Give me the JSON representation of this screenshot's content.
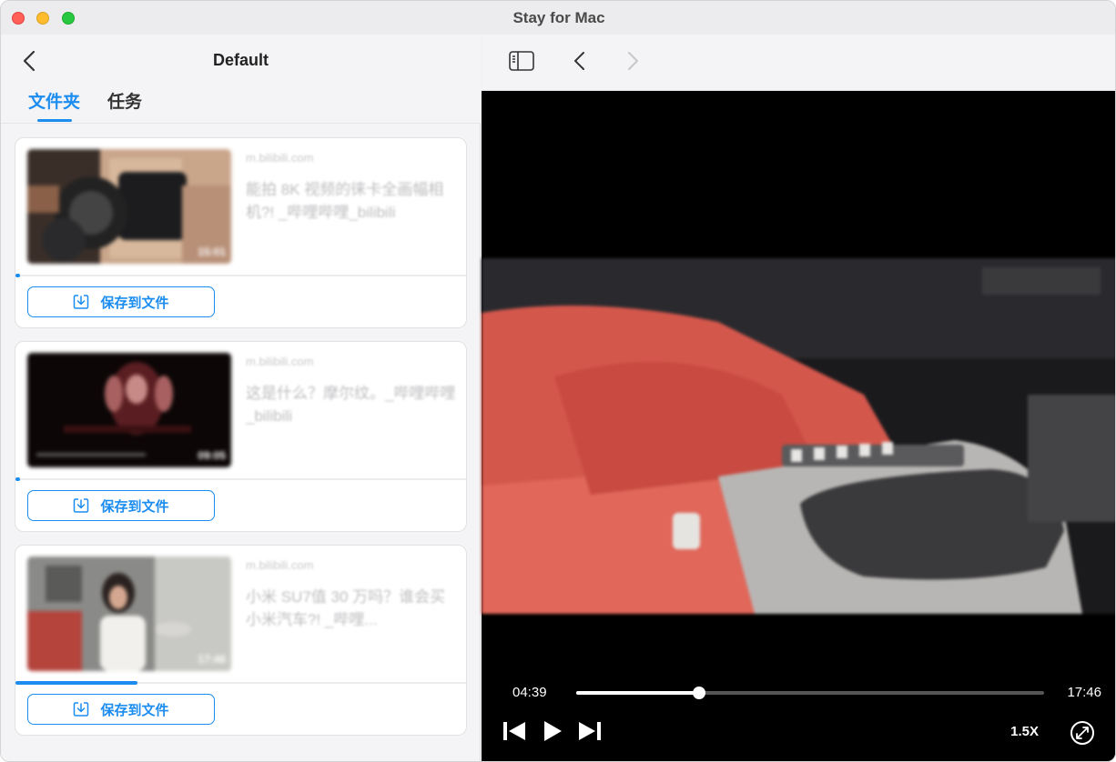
{
  "window": {
    "title": "Stay for Mac"
  },
  "sidebar": {
    "title": "Default",
    "tabs": [
      {
        "label": "文件夹",
        "active": true
      },
      {
        "label": "任务",
        "active": false
      }
    ],
    "items": [
      {
        "source": "m.bilibili.com",
        "title": "能拍 8K 视频的徕卡全画幅相机?! _哔哩哔哩_bilibili",
        "duration": "15:01",
        "progress": 0.01,
        "save_label": "保存到文件"
      },
      {
        "source": "m.bilibili.com",
        "title": "这是什么？摩尔纹。_哔哩哔哩_bilibili",
        "duration": "09:05",
        "progress": 0.01,
        "save_label": "保存到文件"
      },
      {
        "source": "m.bilibili.com",
        "title": "小米 SU7值 30 万吗？谁会买小米汽车?! _哔哩...",
        "duration": "17:46",
        "progress": 0.27,
        "save_label": "保存到文件"
      }
    ]
  },
  "player": {
    "current_time": "04:39",
    "total_time": "17:46",
    "progress": 0.262,
    "speed": "1.5X",
    "icons": [
      "sidebar-toggle-icon",
      "chevron-left-icon",
      "chevron-right-icon",
      "skip-back-icon",
      "play-icon",
      "skip-forward-icon",
      "fullscreen-icon"
    ]
  },
  "colors": {
    "accent": "#1b8cf0",
    "video_bg": "#000000"
  }
}
